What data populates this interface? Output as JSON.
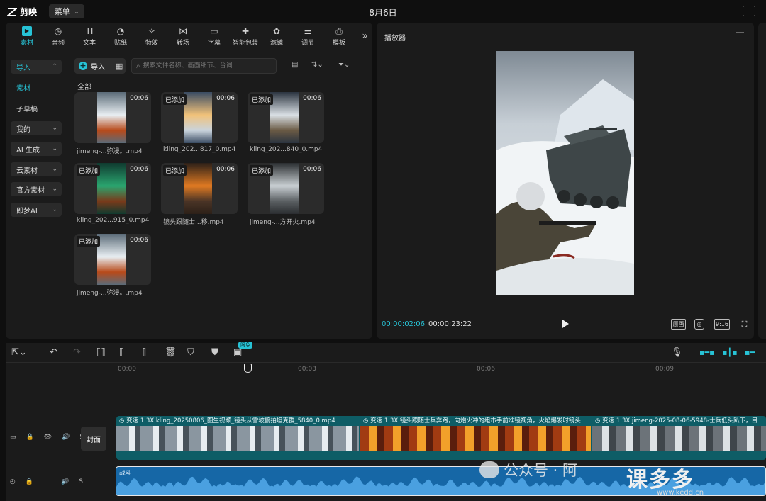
{
  "app": {
    "name": "剪映",
    "menu_label": "菜单",
    "date": "8月6日"
  },
  "tabs": [
    {
      "label": "素材",
      "icon": "media-icon",
      "active": true
    },
    {
      "label": "音频",
      "icon": "audio-icon"
    },
    {
      "label": "文本",
      "icon": "text-icon"
    },
    {
      "label": "贴纸",
      "icon": "sticker-icon"
    },
    {
      "label": "特效",
      "icon": "effects-icon"
    },
    {
      "label": "转场",
      "icon": "transition-icon"
    },
    {
      "label": "字幕",
      "icon": "subtitle-icon"
    },
    {
      "label": "智能包装",
      "icon": "smart-pack-icon"
    },
    {
      "label": "滤镜",
      "icon": "filter-icon"
    },
    {
      "label": "调节",
      "icon": "adjust-icon"
    },
    {
      "label": "模板",
      "icon": "template-icon"
    }
  ],
  "sidebar": {
    "items": [
      {
        "label": "导入",
        "expanded": true,
        "active": true
      },
      {
        "label": "素材",
        "active": true
      },
      {
        "label": "子草稿"
      },
      {
        "label": "我的"
      },
      {
        "label": "AI 生成"
      },
      {
        "label": "云素材"
      },
      {
        "label": "官方素材"
      },
      {
        "label": "即梦AI"
      }
    ]
  },
  "media": {
    "import_label": "导入",
    "search_placeholder": "搜索文件名称、画面细节、台词",
    "all_label": "全部",
    "added_tag": "已添加",
    "items": [
      {
        "name": "jimeng-...弥漫。.mp4",
        "duration": "00:06",
        "added": false
      },
      {
        "name": "kling_202...817_0.mp4",
        "duration": "00:06",
        "added": true
      },
      {
        "name": "kling_202...840_0.mp4",
        "duration": "00:06",
        "added": true
      },
      {
        "name": "kling_202...915_0.mp4",
        "duration": "00:06",
        "added": true
      },
      {
        "name": "镜头跟随士...移.mp4",
        "duration": "00:06",
        "added": true
      },
      {
        "name": "jimeng-...方开火.mp4",
        "duration": "00:06",
        "added": true
      },
      {
        "name": "jimeng-...弥漫。.mp4",
        "duration": "00:06",
        "added": true
      }
    ]
  },
  "player": {
    "title": "播放器",
    "current_time": "00:00:02:06",
    "total_time": "00:00:23:22",
    "ratio": "9:16",
    "button_original": "原画"
  },
  "timeline": {
    "free_badge": "限免",
    "ticks": [
      "00:00",
      "00:03",
      "00:06",
      "00:09"
    ],
    "cover_label": "封面",
    "clips": [
      {
        "label": "变速 1.3X   kling_20250806_图生视频_镜头从雪坡俯拍坦克群_5840_0.mp4"
      },
      {
        "label": "变速 1.3X   镜头跟随士兵奔跑，向炮火冲的组市手前准镜视角，火焰爆发时镜头"
      },
      {
        "label": "变速 1.3X   jimeng-2025-08-06-5948-士兵低头趴下，目"
      }
    ],
    "audio_label": "战斗",
    "track_controls": {
      "s": "S"
    }
  },
  "watermark": {
    "text": "公众号 · 阿",
    "brand": "课多多",
    "url": "www.kedd.cn"
  }
}
